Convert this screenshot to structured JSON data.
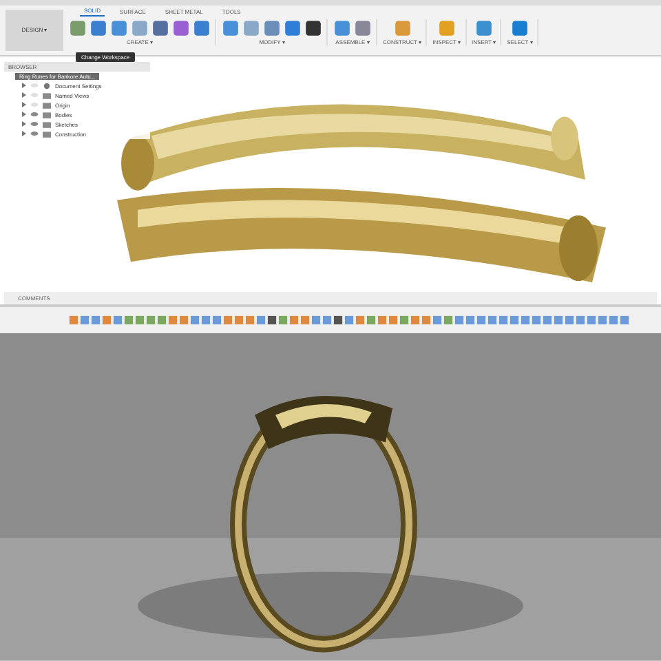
{
  "workspace_button": {
    "label": "DESIGN ▾"
  },
  "tabs": [
    {
      "label": "SOLID",
      "selected": true
    },
    {
      "label": "SURFACE",
      "selected": false
    },
    {
      "label": "SHEET METAL",
      "selected": false
    },
    {
      "label": "TOOLS",
      "selected": false
    }
  ],
  "tool_groups": [
    {
      "label": "CREATE ▾",
      "tools": [
        {
          "kind": "sketch"
        },
        {
          "kind": "box"
        },
        {
          "kind": "cyl"
        },
        {
          "kind": "shell"
        },
        {
          "kind": "dim"
        },
        {
          "kind": "sphere"
        },
        {
          "kind": "form"
        }
      ]
    },
    {
      "label": "MODIFY ▾",
      "tools": [
        {
          "kind": "press"
        },
        {
          "kind": "fillet"
        },
        {
          "kind": "chamfer"
        },
        {
          "kind": "combine"
        },
        {
          "kind": "move"
        }
      ]
    },
    {
      "label": "ASSEMBLE ▾",
      "tools": [
        {
          "kind": "joint"
        },
        {
          "kind": "rigid"
        }
      ]
    },
    {
      "label": "CONSTRUCT ▾",
      "tools": [
        {
          "kind": "plane"
        }
      ]
    },
    {
      "label": "INSPECT ▾",
      "tools": [
        {
          "kind": "measure"
        }
      ]
    },
    {
      "label": "INSERT ▾"
    },
    {
      "label": "SELECT ▾",
      "tools": [
        {
          "kind": "select"
        }
      ]
    }
  ],
  "tooltip": "Change Workspace",
  "browser": {
    "title": "BROWSER",
    "root": "Ring Runes for Bankore Autu...",
    "items": [
      {
        "label": "Document Settings",
        "kind": "gear",
        "visible": false
      },
      {
        "label": "Named Views",
        "kind": "folder",
        "visible": false
      },
      {
        "label": "Origin",
        "kind": "folder",
        "visible": false
      },
      {
        "label": "Bodies",
        "kind": "folder",
        "visible": true
      },
      {
        "label": "Sketches",
        "kind": "folder",
        "visible": true
      },
      {
        "label": "Construction",
        "kind": "folder",
        "visible": true
      }
    ]
  },
  "comments": {
    "label": "COMMENTS"
  },
  "timeline": [
    {
      "kind": "sketch"
    },
    {
      "kind": "extrude"
    },
    {
      "kind": "extrude"
    },
    {
      "kind": "sketch"
    },
    {
      "kind": "extrude"
    },
    {
      "kind": "form"
    },
    {
      "kind": "form"
    },
    {
      "kind": "form"
    },
    {
      "kind": "form"
    },
    {
      "kind": "combine"
    },
    {
      "kind": "combine"
    },
    {
      "kind": "extrude"
    },
    {
      "kind": "extrude"
    },
    {
      "kind": "extrude"
    },
    {
      "kind": "sketch"
    },
    {
      "kind": "sketch"
    },
    {
      "kind": "sketch"
    },
    {
      "kind": "extrude"
    },
    {
      "kind": "move"
    },
    {
      "kind": "form"
    },
    {
      "kind": "sketch"
    },
    {
      "kind": "sketch"
    },
    {
      "kind": "extrude"
    },
    {
      "kind": "extrude"
    },
    {
      "kind": "move"
    },
    {
      "kind": "extrude"
    },
    {
      "kind": "sketch"
    },
    {
      "kind": "form"
    },
    {
      "kind": "sketch"
    },
    {
      "kind": "sketch"
    },
    {
      "kind": "form"
    },
    {
      "kind": "sketch"
    },
    {
      "kind": "sketch"
    },
    {
      "kind": "extrude"
    },
    {
      "kind": "form"
    },
    {
      "kind": "extrude"
    },
    {
      "kind": "extrude"
    },
    {
      "kind": "extrude"
    },
    {
      "kind": "extrude"
    },
    {
      "kind": "extrude"
    },
    {
      "kind": "extrude"
    },
    {
      "kind": "extrude"
    },
    {
      "kind": "extrude"
    },
    {
      "kind": "extrude"
    },
    {
      "kind": "extrude"
    },
    {
      "kind": "extrude"
    },
    {
      "kind": "extrude"
    },
    {
      "kind": "extrude"
    },
    {
      "kind": "extrude"
    },
    {
      "kind": "extrude"
    },
    {
      "kind": "extrude"
    }
  ]
}
